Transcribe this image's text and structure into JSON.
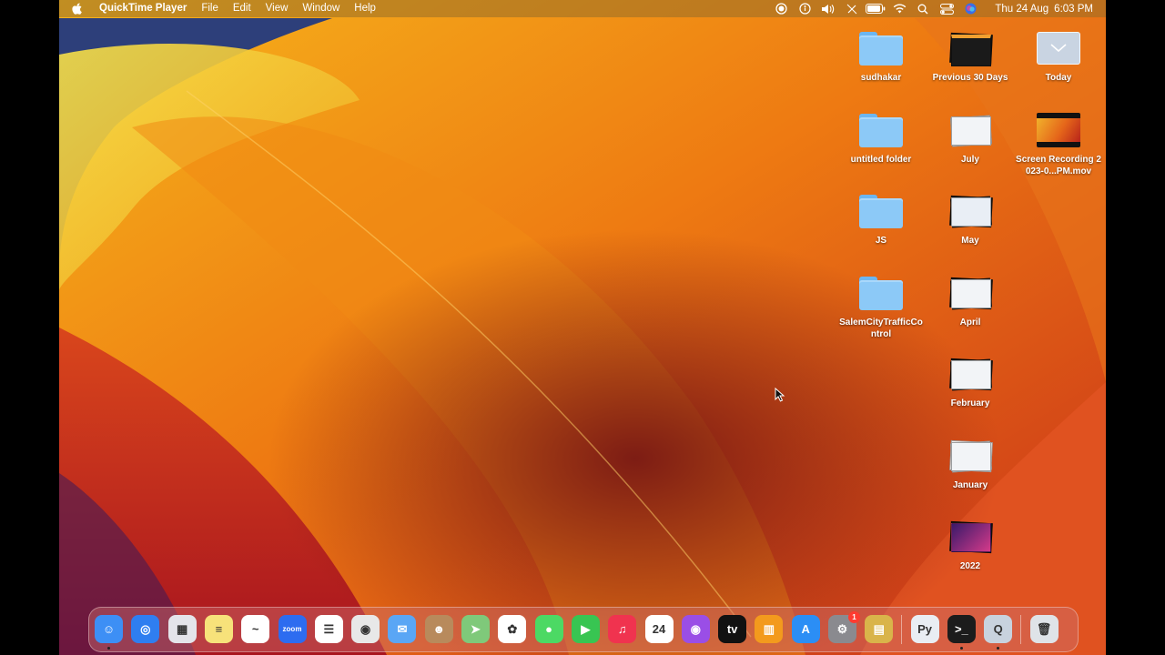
{
  "menubar": {
    "app_name": "QuickTime Player",
    "menus": [
      "File",
      "Edit",
      "View",
      "Window",
      "Help"
    ],
    "status_icons": [
      "screen-record-icon",
      "accessibility-icon",
      "volume-icon",
      "pen-slash-icon",
      "battery-icon",
      "wifi-icon",
      "spotlight-search-icon",
      "control-center-icon",
      "siri-icon"
    ],
    "date": "Thu 24 Aug",
    "time": "6:03 PM"
  },
  "desktop": {
    "column1": [
      {
        "label": "sudhakar",
        "icon": "folder-icon"
      },
      {
        "label": "untitled folder",
        "icon": "folder-icon"
      },
      {
        "label": "JS",
        "icon": "folder-icon"
      },
      {
        "label": "SalemCityTrafficControl",
        "icon": "folder-icon"
      }
    ],
    "column2": [
      {
        "label": "Previous 30 Days",
        "icon": "stack-icon"
      },
      {
        "label": "July",
        "icon": "stack-icon"
      },
      {
        "label": "May",
        "icon": "stack-icon"
      },
      {
        "label": "April",
        "icon": "stack-icon"
      },
      {
        "label": "February",
        "icon": "stack-icon"
      },
      {
        "label": "January",
        "icon": "stack-icon"
      },
      {
        "label": "2022",
        "icon": "stack-icon"
      }
    ],
    "column3": [
      {
        "label": "Today",
        "icon": "stack-icon"
      },
      {
        "label": "Screen Recording 2023-0...PM.mov",
        "icon": "video-file-icon"
      }
    ]
  },
  "dock": {
    "apps": [
      {
        "name": "finder-icon",
        "color": "#3d8ff5",
        "glyph": "☺",
        "running": true
      },
      {
        "name": "safari-icon",
        "color": "#2f7ef0",
        "glyph": "◎",
        "running": false
      },
      {
        "name": "launchpad-icon",
        "color": "#e4e4ea",
        "glyph": "▦",
        "running": false
      },
      {
        "name": "notes-icon",
        "color": "#f7e27a",
        "glyph": "≡",
        "running": false
      },
      {
        "name": "freeform-icon",
        "color": "#ffffff",
        "glyph": "~",
        "running": false
      },
      {
        "name": "zoom-icon",
        "color": "#2d6cf0",
        "glyph": "zoom",
        "running": false
      },
      {
        "name": "reminders-icon",
        "color": "#ffffff",
        "glyph": "☰",
        "running": false
      },
      {
        "name": "chrome-icon",
        "color": "#e8e8e8",
        "glyph": "◉",
        "running": false
      },
      {
        "name": "mail-icon",
        "color": "#5aa6f5",
        "glyph": "✉",
        "running": false
      },
      {
        "name": "contacts-icon",
        "color": "#b88a5c",
        "glyph": "☻",
        "running": false
      },
      {
        "name": "maps-icon",
        "color": "#7fc97a",
        "glyph": "➤",
        "running": false
      },
      {
        "name": "photos-icon",
        "color": "#ffffff",
        "glyph": "✿",
        "running": false
      },
      {
        "name": "messages-icon",
        "color": "#4cd964",
        "glyph": "●",
        "running": false
      },
      {
        "name": "facetime-icon",
        "color": "#38c552",
        "glyph": "▶",
        "running": false
      },
      {
        "name": "music-icon",
        "color": "#f0334f",
        "glyph": "♫",
        "running": false
      },
      {
        "name": "calendar-icon",
        "color": "#ffffff",
        "glyph": "24",
        "running": false
      },
      {
        "name": "podcasts-icon",
        "color": "#9a4ee6",
        "glyph": "◉",
        "running": false
      },
      {
        "name": "apple-tv-icon",
        "color": "#111111",
        "glyph": "tv",
        "running": false
      },
      {
        "name": "books-icon",
        "color": "#f39a1d",
        "glyph": "▥",
        "running": false
      },
      {
        "name": "app-store-icon",
        "color": "#2b8ef5",
        "glyph": "A",
        "running": false
      },
      {
        "name": "system-settings-icon",
        "color": "#8a8a8f",
        "glyph": "⚙",
        "running": false,
        "badge": "1"
      },
      {
        "name": "archive-utility-icon",
        "color": "#d9b44a",
        "glyph": "▤",
        "running": false
      }
    ],
    "recent": [
      {
        "name": "python-launcher-icon",
        "color": "#e9edf3",
        "glyph": "Py",
        "running": false
      },
      {
        "name": "terminal-icon",
        "color": "#1c1c1c",
        "glyph": ">_",
        "running": true
      },
      {
        "name": "quicktime-player-icon",
        "color": "#c8d2de",
        "glyph": "Q",
        "running": true
      }
    ],
    "trash": {
      "name": "trash-icon",
      "color": "#dfe3e8",
      "glyph": "🗑"
    }
  }
}
